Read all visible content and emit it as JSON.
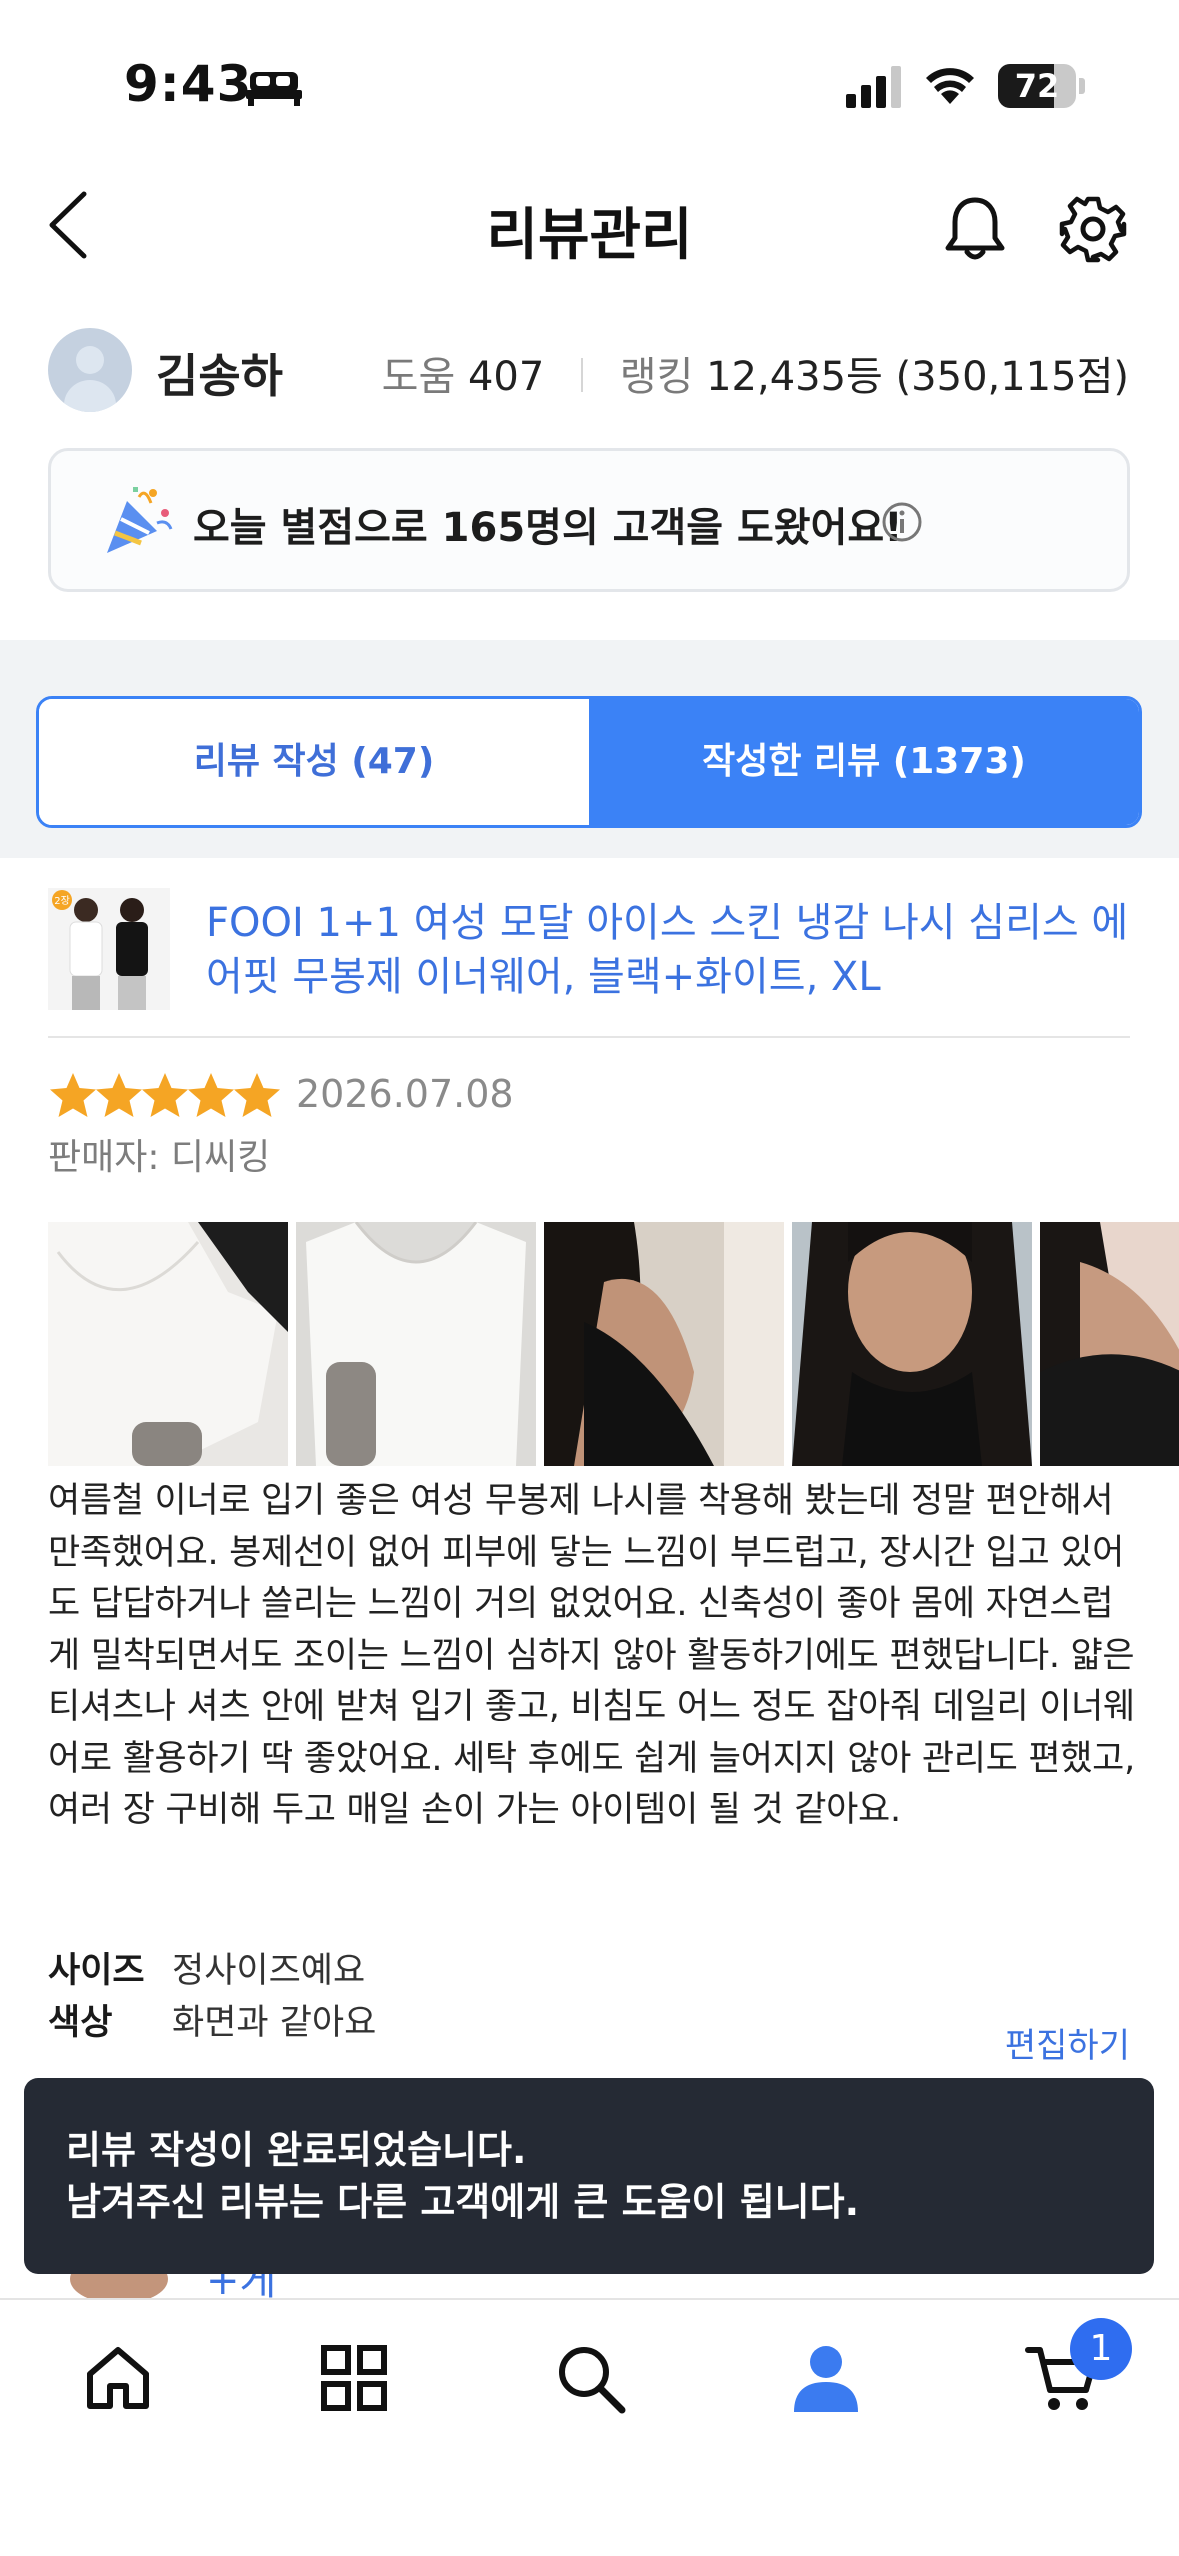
{
  "status_bar": {
    "time": "9:43",
    "battery": "72",
    "battery_level": 0.72
  },
  "header": {
    "title": "리뷰관리"
  },
  "profile": {
    "name": "김송하",
    "help_label": "도움",
    "help_value": "407",
    "rank_label": "랭킹",
    "rank_value": "12,435등 (350,115점)"
  },
  "banner": {
    "text": "오늘 별점으로 165명의 고객을 도왔어요!"
  },
  "tabs": [
    {
      "label": "리뷰 작성 (47)",
      "selected": false
    },
    {
      "label": "작성한 리뷰 (1373)",
      "selected": true
    }
  ],
  "review": {
    "product_badge": "2장",
    "product_title": "FOOI 1+1 여성 모달 아이스 스킨 냉감 나시 심리스 에어핏 무봉제 이너웨어, 블랙+화이트, XL",
    "rating": 5,
    "date": "2026.07.08",
    "seller": "판매자: 디씨킹",
    "photo_count": 5,
    "text": "여름철 이너로 입기 좋은 여성 무봉제 나시를 착용해 봤는데 정말 편안해서 만족했어요. 봉제선이 없어 피부에 닿는 느낌이 부드럽고, 장시간 입고 있어도 답답하거나 쓸리는 느낌이 거의 없었어요. 신축성이 좋아 몸에 자연스럽게 밀착되면서도 조이는 느낌이 심하지 않아 활동하기에도 편했답니다. 얇은 티셔츠나 셔츠 안에 받쳐 입기 좋고, 비침도 어느 정도 잡아줘 데일리 이너웨어로 활용하기 딱 좋았어요. 세탁 후에도 쉽게 늘어지지 않아 관리도 편했고, 여러 장 구비해 두고 매일 손이 가는 아이템이 될 것 같아요.",
    "details": [
      {
        "label": "사이즈",
        "value": "정사이즈예요"
      },
      {
        "label": "색상",
        "value": "화면과 같아요"
      }
    ],
    "edit_label": "편집하기"
  },
  "next_review_peek": "+게",
  "toast": {
    "line1": "리뷰 작성이 완료되었습니다.",
    "line2": "남겨주신 리뷰는 다른 고객에게 큰 도움이 됩니다."
  },
  "bottom_nav": {
    "items": [
      "home-icon",
      "grid-icon",
      "search-icon",
      "user-icon",
      "cart-icon"
    ],
    "active": "user-icon",
    "cart_count": "1"
  },
  "colors": {
    "accent": "#3b82f6",
    "link": "#3b72e0",
    "star": "#f5a524",
    "toast_bg": "#252a34"
  }
}
